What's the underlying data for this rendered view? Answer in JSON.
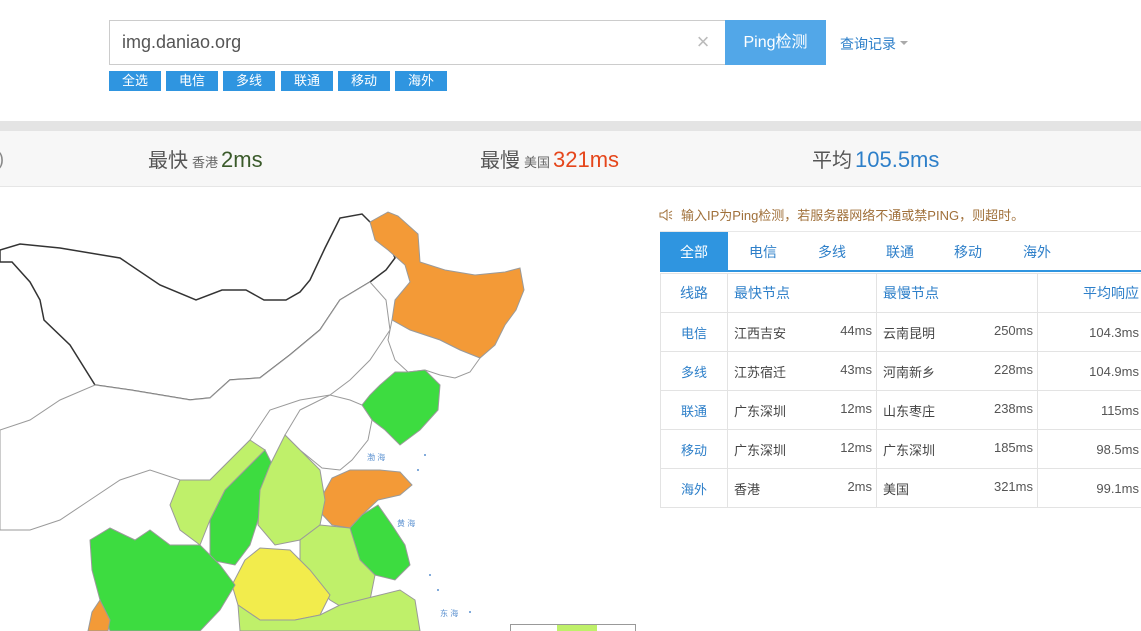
{
  "search": {
    "value": "img.daniao.org",
    "placeholder": ""
  },
  "ping_button": "Ping检测",
  "history_link": "查询记录",
  "filters": [
    "全选",
    "电信",
    "多线",
    "联通",
    "移动",
    "海外"
  ],
  "summary": {
    "fastest": {
      "label": "最快",
      "location": "香港",
      "value": "2ms",
      "color": "#3a5a2a"
    },
    "slowest": {
      "label": "最慢",
      "location": "美国",
      "value": "321ms",
      "color": "#e5461b"
    },
    "average": {
      "label": "平均",
      "value": "105.5ms",
      "color": "#2d7fc9"
    }
  },
  "notice": "输入IP为Ping检测，若服务器网络不通或禁PING，则超时。",
  "tabs": [
    "全部",
    "电信",
    "多线",
    "联通",
    "移动",
    "海外"
  ],
  "active_tab": "全部",
  "table": {
    "headers": {
      "line": "线路",
      "fastest": "最快节点",
      "slowest": "最慢节点",
      "avg": "平均响应"
    },
    "rows": [
      {
        "line": "电信",
        "fast_node": "江西吉安",
        "fast_ms": "44ms",
        "slow_node": "云南昆明",
        "slow_ms": "250ms",
        "avg": "104.3ms"
      },
      {
        "line": "多线",
        "fast_node": "江苏宿迁",
        "fast_ms": "43ms",
        "slow_node": "河南新乡",
        "slow_ms": "228ms",
        "avg": "104.9ms"
      },
      {
        "line": "联通",
        "fast_node": "广东深圳",
        "fast_ms": "12ms",
        "slow_node": "山东枣庄",
        "slow_ms": "238ms",
        "avg": "115ms"
      },
      {
        "line": "移动",
        "fast_node": "广东深圳",
        "fast_ms": "12ms",
        "slow_node": "广东深圳",
        "slow_ms": "185ms",
        "avg": "98.5ms"
      },
      {
        "line": "海外",
        "fast_node": "香港",
        "fast_ms": "2ms",
        "slow_node": "美国",
        "slow_ms": "321ms",
        "avg": "99.1ms"
      }
    ]
  },
  "map": {
    "colors": {
      "orange": "#f39a37",
      "green": "#3ddc40",
      "lightgreen": "#bff06a",
      "yellow": "#f2ec4c",
      "white": "#ffffff"
    },
    "sea_labels": [
      "渤 海",
      "黄 海",
      "东 海"
    ]
  }
}
